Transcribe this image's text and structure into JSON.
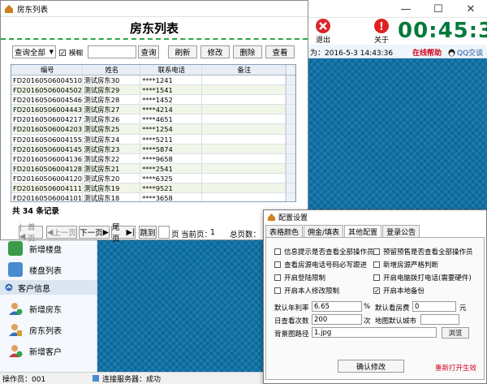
{
  "main": {
    "exit_label": "退出",
    "about_label": "关于",
    "clock": "00:45:37",
    "login_time_text": "为：2016-5-3 14:43:36",
    "online_help": "在线帮助",
    "qq_chat": "QQ交谈",
    "window_controls": [
      "—",
      "☐",
      "✕"
    ]
  },
  "sidebar": {
    "items_top": [
      "新增楼盘",
      "楼盘列表"
    ],
    "section_customer": "客户信息",
    "items_customer": [
      "新增房东",
      "房东列表",
      "新增客户"
    ]
  },
  "statusbar": {
    "operator": "操作员：001",
    "server": "连接服务器：成功"
  },
  "list_window": {
    "title": "房东列表",
    "heading": "房东列表",
    "query_select": "查询全部",
    "fuzzy_label": "模糊",
    "query_button": "查询",
    "refresh_button": "刷新",
    "edit_button": "修改",
    "delete_button": "删除",
    "view_button": "查看",
    "columns": [
      "编号",
      "姓名",
      "联系电话",
      "备注"
    ],
    "rows": [
      {
        "id": "FD20160506004510130",
        "name": "测试房东30",
        "phone": "****1241",
        "note": ""
      },
      {
        "id": "FD20160506004502802",
        "name": "测试房东29",
        "phone": "****1541",
        "note": ""
      },
      {
        "id": "FD20160506004546770",
        "name": "测试房东28",
        "phone": "****1452",
        "note": ""
      },
      {
        "id": "FD20160506004443170",
        "name": "测试房东27",
        "phone": "****4214",
        "note": ""
      },
      {
        "id": "FD20160506004217755",
        "name": "测试房东26",
        "phone": "****4651",
        "note": ""
      },
      {
        "id": "FD20160506004203005",
        "name": "测试房东25",
        "phone": "****1254",
        "note": ""
      },
      {
        "id": "FD20160506004155286",
        "name": "测试房东24",
        "phone": "****5211",
        "note": ""
      },
      {
        "id": "FD20160506004145802",
        "name": "测试房东23",
        "phone": "****5874",
        "note": ""
      },
      {
        "id": "FD20160506004136942",
        "name": "测试房东22",
        "phone": "****9658",
        "note": ""
      },
      {
        "id": "FD20160506004128677",
        "name": "测试房东21",
        "phone": "****2541",
        "note": ""
      },
      {
        "id": "FD20160506004120458",
        "name": "测试房东20",
        "phone": "****6325",
        "note": ""
      },
      {
        "id": "FD20160506004111786",
        "name": "测试房东19",
        "phone": "****9521",
        "note": ""
      },
      {
        "id": "FD20160506004101234",
        "name": "测试房东18",
        "phone": "****3658",
        "note": ""
      }
    ],
    "total_text": "共 34 条记录",
    "pager": {
      "first": "首页",
      "prev": "上一页",
      "next": "下一页",
      "last": "尾页",
      "jump": "跳到",
      "page_unit": "页",
      "current_label": "当前页：",
      "current_value": "1",
      "total_pages_label": "总页数："
    }
  },
  "config_window": {
    "title": "配置设置",
    "tabs": [
      "表格颜色",
      "佣金/填表",
      "其他配置",
      "登录公告"
    ],
    "checkboxes": [
      {
        "label": "信息提示是否查看全部操作员",
        "checked": false
      },
      {
        "label": "预留预售是否查看全部操作员",
        "checked": false
      },
      {
        "label": "查看房源电话号码必写跟进",
        "checked": false
      },
      {
        "label": "新增房源严格判断",
        "checked": false
      },
      {
        "label": "开启登陆限制",
        "checked": false
      },
      {
        "label": "开启电脑拨打电话(需要硬件)",
        "checked": false
      },
      {
        "label": "开启本人修改限制",
        "checked": false
      },
      {
        "label": "开启本地备份",
        "checked": true
      }
    ],
    "annual_rate_label": "默认年利率",
    "annual_rate_value": "6.65",
    "annual_rate_unit": "%",
    "view_fee_label": "默认看房费",
    "view_fee_value": "0",
    "view_fee_unit": "元",
    "daily_view_label": "日查看次数",
    "daily_view_value": "200",
    "daily_view_unit": "次",
    "map_city_label": "地图默认城市",
    "map_city_value": "",
    "bg_path_label": "背景图路径",
    "bg_path_value": "1.jpg",
    "browse_button": "浏览",
    "confirm_button": "确认修改",
    "restart_note": "重新打开生效"
  }
}
